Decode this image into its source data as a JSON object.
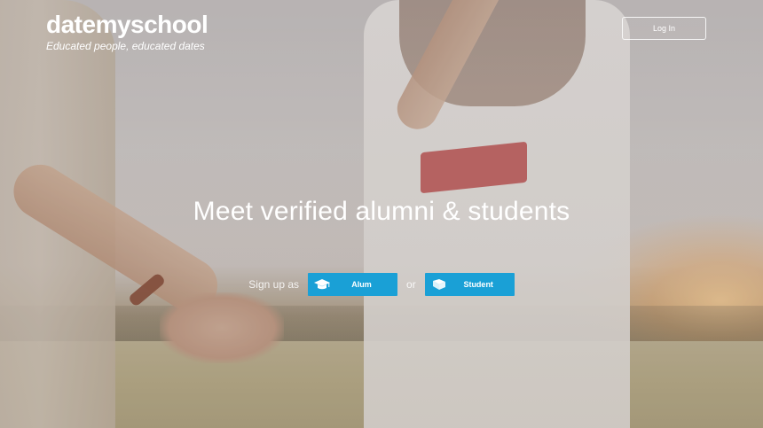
{
  "brand": {
    "name": "datemyschool",
    "tagline": "Educated people, educated dates"
  },
  "header": {
    "login_label": "Log In"
  },
  "hero": {
    "headline": "Meet verified alumni & students",
    "signup_prefix": "Sign up as",
    "or_label": "or",
    "alum_label": "Alum",
    "alum_icon": "graduation-cap-icon",
    "student_label": "Student",
    "student_icon": "book-icon"
  },
  "colors": {
    "button_blue": "#1aa0d6",
    "text_white": "#ffffff"
  }
}
